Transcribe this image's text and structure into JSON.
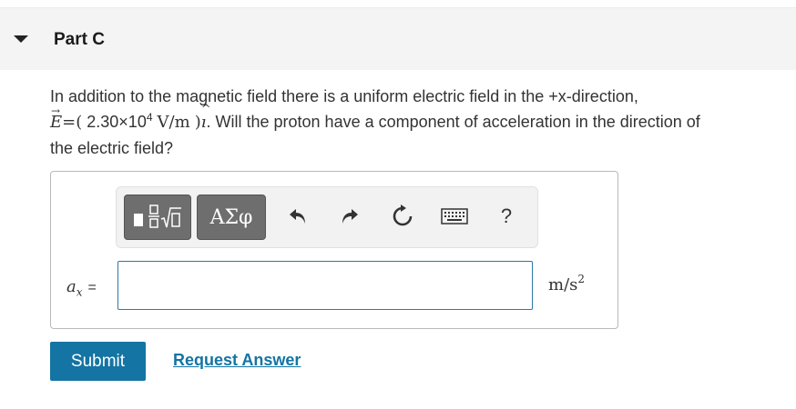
{
  "part": {
    "title": "Part C"
  },
  "question": {
    "line1": "In addition to the magnetic field there is a uniform electric field in the +x-direction,",
    "field_symbol": "E",
    "equals_paren": "=(",
    "value_mantissa": "2.30×10",
    "value_exponent": "4",
    "field_units": "V/m",
    "close_paren": ")",
    "unit_vector": "ı",
    "line2_rest": ". Will the proton have a component of acceleration in the direction of",
    "line3": "the electric field?"
  },
  "toolbar": {
    "buttons": [
      {
        "name": "templates-button",
        "icon": "fraction-radical-icon"
      },
      {
        "name": "symbols-button",
        "label": "ΑΣφ"
      },
      {
        "name": "undo-button",
        "icon": "undo-icon"
      },
      {
        "name": "redo-button",
        "icon": "redo-icon"
      },
      {
        "name": "reset-button",
        "icon": "reset-icon"
      },
      {
        "name": "keyboard-button",
        "icon": "keyboard-icon"
      },
      {
        "name": "help-button",
        "label": "?"
      }
    ]
  },
  "answer": {
    "variable": "a",
    "subscript": "x",
    "equals": "=",
    "value": "",
    "units_base": "m/s",
    "units_exp": "2"
  },
  "actions": {
    "submit_label": "Submit",
    "request_label": "Request Answer"
  },
  "colors": {
    "accent": "#1474a3",
    "header_bg": "#f4f4f4",
    "toolbar_dark": "#6e6e6e"
  }
}
